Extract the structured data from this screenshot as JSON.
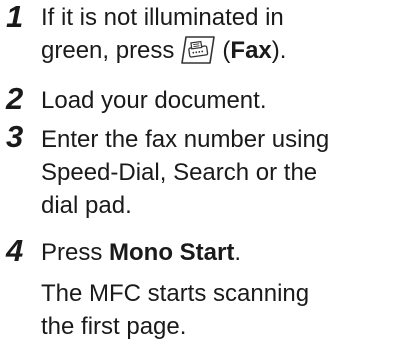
{
  "steps": [
    {
      "number": "1",
      "line1": "If it is not illuminated in",
      "line2_pre": "green, press",
      "line2_paren_open": "(",
      "line2_bold": "Fax",
      "line2_post": ").",
      "key_icon": "fax-machine-icon"
    },
    {
      "number": "2",
      "line1": "Load your document."
    },
    {
      "number": "3",
      "line1": "Enter the fax number using",
      "line2": "Speed-Dial, Search or the",
      "line3": "dial pad."
    },
    {
      "number": "4",
      "line1_pre": "Press ",
      "line1_bold": "Mono Start",
      "line1_post": ".",
      "note1": "The MFC starts scanning",
      "note2": "the first page."
    }
  ]
}
